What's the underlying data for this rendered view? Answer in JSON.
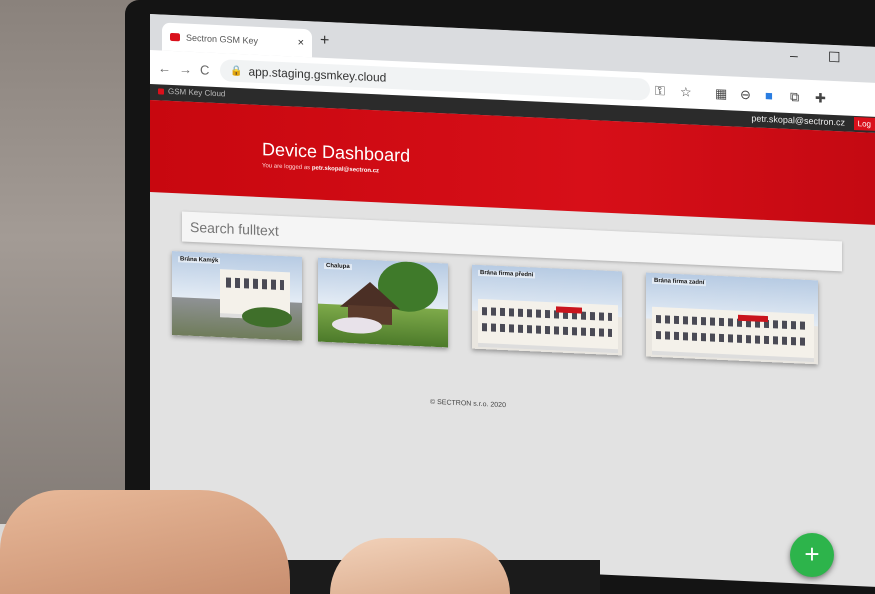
{
  "browser": {
    "tab_title": "Sectron GSM Key",
    "tab_close": "×",
    "new_tab": "+",
    "url": "app.staging.gsmkey.cloud",
    "window_min": "–",
    "window_max": "☐",
    "nav_back": "←",
    "nav_forward": "→",
    "nav_reload": "C"
  },
  "app": {
    "brand": "GSM Key Cloud",
    "user_email": "petr.skopal@sectron.cz",
    "logout_label": "Log"
  },
  "hero": {
    "title": "Device Dashboard",
    "subtitle_prefix": "You are logged as",
    "subtitle_email": "petr.skopal@sectron.cz"
  },
  "search": {
    "placeholder": "Search fulltext"
  },
  "devices": [
    {
      "label": "Brána Kamýk"
    },
    {
      "label": "Chalupa"
    },
    {
      "label": "Brána firma předni"
    },
    {
      "label": "Brána firma zadní"
    }
  ],
  "footer": {
    "text": "© SECTRON s.r.o. 2020"
  },
  "fab": {
    "label": "+"
  },
  "colors": {
    "brand_red": "#d9101b",
    "fab_green": "#2db44b"
  }
}
